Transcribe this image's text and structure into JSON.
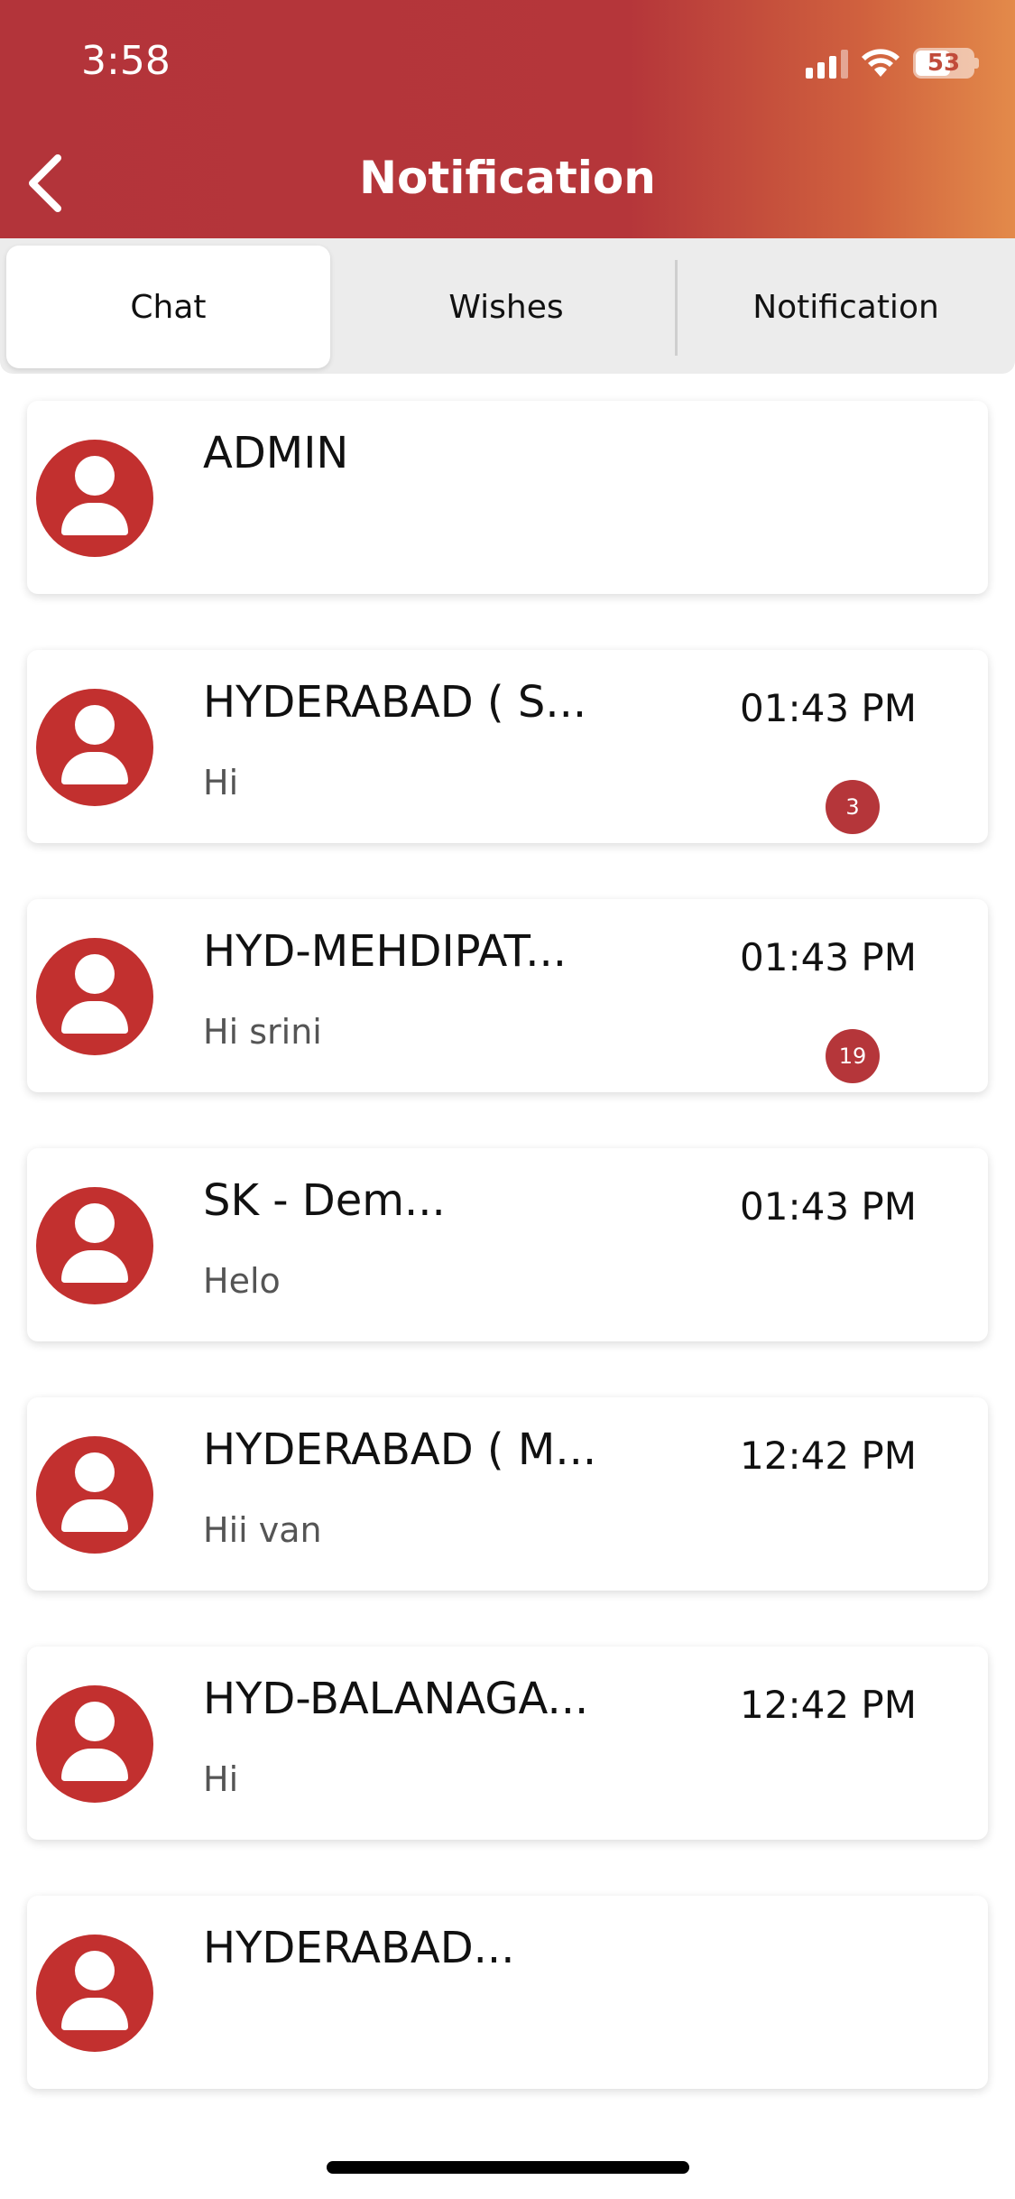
{
  "status_bar": {
    "time": "3:58",
    "battery": "53"
  },
  "header": {
    "title": "Notification"
  },
  "tabs": [
    {
      "label": "Chat",
      "active": true
    },
    {
      "label": "Wishes",
      "active": false
    },
    {
      "label": "Notification",
      "active": false
    }
  ],
  "chats": [
    {
      "name": "ADMIN",
      "message": "",
      "time": "",
      "badge": ""
    },
    {
      "name": "HYDERABAD ( S...",
      "message": "Hi",
      "time": "01:43 PM",
      "badge": "3"
    },
    {
      "name": "HYD-MEHDIPAT...",
      "message": "Hi srini",
      "time": "01:43 PM",
      "badge": "19"
    },
    {
      "name": "SK - Dem...",
      "message": "Helo",
      "time": "01:43 PM",
      "badge": ""
    },
    {
      "name": "HYDERABAD ( M...",
      "message": "Hii van",
      "time": "12:42 PM",
      "badge": ""
    },
    {
      "name": "HYD-BALANAGA...",
      "message": "Hi",
      "time": "12:42 PM",
      "badge": ""
    },
    {
      "name": "HYDERABAD...",
      "message": "",
      "time": "",
      "badge": ""
    }
  ],
  "colors": {
    "accent": "#b5363a",
    "avatar": "#c2302f",
    "gradient_end": "#e38a4a"
  }
}
